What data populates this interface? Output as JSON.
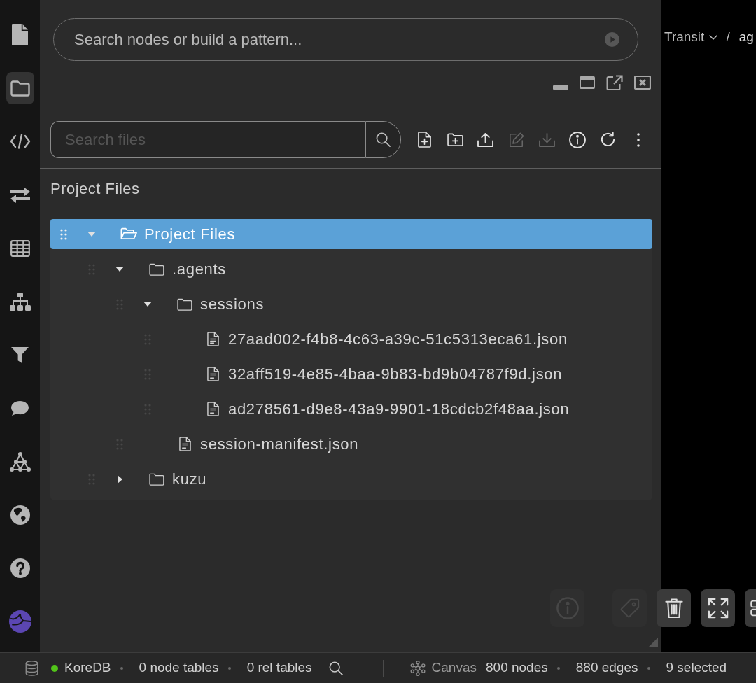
{
  "sidebar": {
    "items": [
      {
        "kind": "document",
        "selected": false
      },
      {
        "kind": "folder",
        "selected": true
      },
      {
        "kind": "code",
        "selected": false
      },
      {
        "kind": "transfer",
        "selected": false
      },
      {
        "kind": "table",
        "selected": false
      },
      {
        "kind": "hierarchy",
        "selected": false
      },
      {
        "kind": "filter",
        "selected": false
      },
      {
        "kind": "chat",
        "selected": false
      },
      {
        "kind": "graph",
        "selected": false
      },
      {
        "kind": "globe",
        "selected": false
      },
      {
        "kind": "help",
        "selected": false
      },
      {
        "kind": "logo",
        "selected": false
      }
    ]
  },
  "pattern_search": {
    "placeholder": "Search nodes or build a pattern..."
  },
  "breadcrumb": {
    "items": [
      {
        "label": "Transit"
      },
      {
        "label": "ag"
      }
    ],
    "separator": "/"
  },
  "file_panel": {
    "search": {
      "placeholder": "Search files"
    },
    "toolbar": [
      {
        "kind": "new-file",
        "disabled": false
      },
      {
        "kind": "new-folder",
        "disabled": false
      },
      {
        "kind": "upload",
        "disabled": false
      },
      {
        "kind": "edit",
        "disabled": true
      },
      {
        "kind": "download",
        "disabled": true
      },
      {
        "kind": "info",
        "disabled": false
      },
      {
        "kind": "refresh",
        "disabled": false
      },
      {
        "kind": "more",
        "disabled": false
      }
    ],
    "title": "Project Files",
    "tree": [
      {
        "kind": "root",
        "name": "Project Files",
        "selected": true,
        "expanded": true,
        "children": [
          {
            "kind": "folder",
            "name": ".agents",
            "selected": false,
            "expanded": true,
            "children": [
              {
                "kind": "folder",
                "name": "sessions",
                "selected": false,
                "expanded": true,
                "children": [
                  {
                    "kind": "file",
                    "name": "27aad002-f4b8-4c63-a39c-51c5313eca61.json",
                    "selected": false
                  },
                  {
                    "kind": "file",
                    "name": "32aff519-4e85-4baa-9b83-bd9b04787f9d.json",
                    "selected": false
                  },
                  {
                    "kind": "file",
                    "name": "ad278561-d9e8-43a9-9901-18cdcb2f48aa.json",
                    "selected": false
                  }
                ]
              },
              {
                "kind": "file",
                "name": "session-manifest.json",
                "selected": false
              }
            ]
          },
          {
            "kind": "folder",
            "name": "kuzu",
            "selected": false,
            "expanded": false
          }
        ]
      }
    ]
  },
  "canvas_toolbar": [
    {
      "kind": "info",
      "disabled": true
    },
    {
      "kind": "tag",
      "disabled": true
    },
    {
      "kind": "trash",
      "disabled": false
    },
    {
      "kind": "expand",
      "disabled": false
    },
    {
      "kind": "link",
      "disabled": false
    }
  ],
  "status_bar": {
    "database": {
      "name": "KoreDB",
      "connected": true
    },
    "node_tables": "0 node tables",
    "rel_tables": "0 rel tables",
    "canvas": {
      "label": "Canvas",
      "nodes": "800 nodes",
      "edges": "880 edges",
      "selected": "9 selected"
    }
  }
}
